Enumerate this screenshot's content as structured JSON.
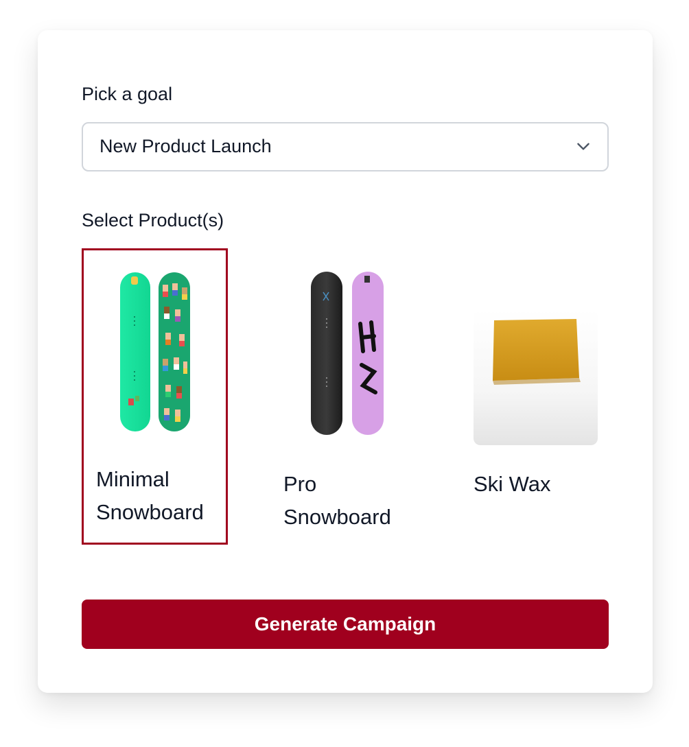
{
  "goal": {
    "label": "Pick a goal",
    "selected": "New Product Launch",
    "icon": "chevron-down-icon"
  },
  "products": {
    "label": "Select Product(s)",
    "items": [
      {
        "name": "Minimal Snowboard",
        "selected": true
      },
      {
        "name": "Pro Snowboard",
        "selected": false
      },
      {
        "name": "Ski Wax",
        "selected": false
      }
    ]
  },
  "actions": {
    "generate_label": "Generate Campaign"
  },
  "colors": {
    "accent": "#a0001e",
    "border": "#d1d5db",
    "text": "#111827"
  }
}
